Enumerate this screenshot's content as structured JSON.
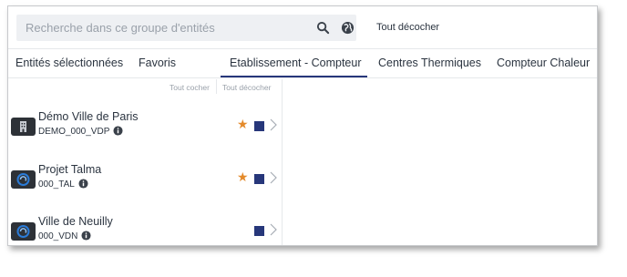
{
  "search": {
    "placeholder": "Recherche dans ce groupe d'entités"
  },
  "header": {
    "uncheck_all": "Tout décocher"
  },
  "tabs": [
    {
      "label": "Entités sélectionnées"
    },
    {
      "label": "Favoris"
    },
    {
      "label": "Etablissement - Compteur",
      "active": true
    },
    {
      "label": "Centres Thermiques"
    },
    {
      "label": "Compteur Chaleur"
    }
  ],
  "list": {
    "check_all": "Tout cocher",
    "uncheck_all": "Tout décocher",
    "items": [
      {
        "name": "Démo Ville de Paris",
        "code": "DEMO_000_VDP",
        "icon": "building-icon",
        "favorite": true
      },
      {
        "name": "Projet Talma",
        "code": "000_TAL",
        "icon": "logo-icon",
        "favorite": true
      },
      {
        "name": "Ville de Neuilly",
        "code": "000_VDN",
        "icon": "logo-icon",
        "favorite": false
      }
    ]
  },
  "colors": {
    "accent": "#27377a",
    "star": "#e48a2b",
    "search_bg": "#eef0f3"
  }
}
